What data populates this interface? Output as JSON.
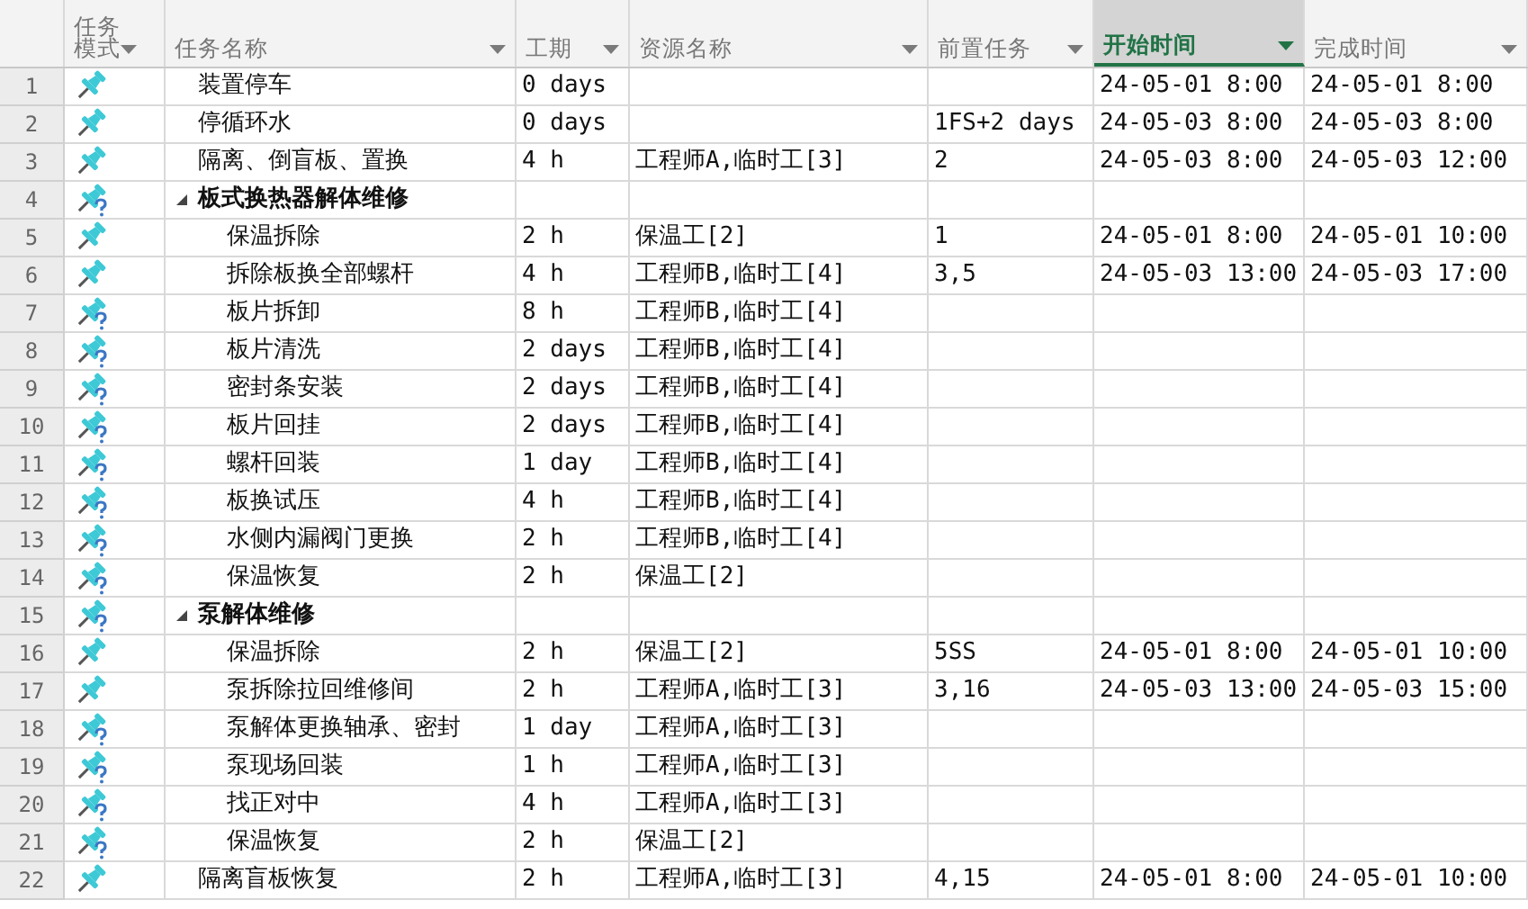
{
  "columns": [
    {
      "label": "任务模式",
      "selected": false
    },
    {
      "label": "任务名称",
      "selected": false
    },
    {
      "label": "工期",
      "selected": false
    },
    {
      "label": "资源名称",
      "selected": false
    },
    {
      "label": "前置任务",
      "selected": false
    },
    {
      "label": "开始时间",
      "selected": true
    },
    {
      "label": "完成时间",
      "selected": false
    }
  ],
  "tasks": [
    {
      "id": "1",
      "kind": "pin",
      "name": "装置停车",
      "duration": "0 days",
      "start": "24-05-01 8:00",
      "finish": "24-05-01 8:00"
    },
    {
      "id": "2",
      "kind": "pin",
      "name": "停循环水",
      "duration": "0 days",
      "predecessors": "1FS+2 days",
      "start": "24-05-03 8:00",
      "finish": "24-05-03 8:00"
    },
    {
      "id": "3",
      "kind": "pin",
      "name": "隔离、倒盲板、置换",
      "duration": "4 h",
      "resources": "工程师A,临时工[3]",
      "predecessors": "2",
      "start": "24-05-03 8:00",
      "finish": "24-05-03 12:00"
    },
    {
      "id": "4",
      "kind": "pin_question",
      "name": "板式换热器解体维修",
      "expanded": true,
      "children": [
        {
          "id": "5",
          "kind": "pin",
          "name": "保温拆除",
          "duration": "2 h",
          "resources": "保温工[2]",
          "predecessors": "1",
          "start": "24-05-01 8:00",
          "finish": "24-05-01 10:00"
        },
        {
          "id": "6",
          "kind": "pin",
          "name": "拆除板换全部螺杆",
          "duration": "4 h",
          "resources": "工程师B,临时工[4]",
          "predecessors": "3,5",
          "start": "24-05-03 13:00",
          "finish": "24-05-03 17:00"
        },
        {
          "id": "7",
          "kind": "pin_question",
          "name": "板片拆卸",
          "duration": "8 h",
          "resources": "工程师B,临时工[4]"
        },
        {
          "id": "8",
          "kind": "pin_question",
          "name": "板片清洗",
          "duration": "2 days",
          "resources": "工程师B,临时工[4]"
        },
        {
          "id": "9",
          "kind": "pin_question",
          "name": "密封条安装",
          "duration": "2 days",
          "resources": "工程师B,临时工[4]"
        },
        {
          "id": "10",
          "kind": "pin_question",
          "name": "板片回挂",
          "duration": "2 days",
          "resources": "工程师B,临时工[4]"
        },
        {
          "id": "11",
          "kind": "pin_question",
          "name": "螺杆回装",
          "duration": "1 day",
          "resources": "工程师B,临时工[4]"
        },
        {
          "id": "12",
          "kind": "pin_question",
          "name": "板换试压",
          "duration": "4 h",
          "resources": "工程师B,临时工[4]"
        },
        {
          "id": "13",
          "kind": "pin_question",
          "name": "水侧内漏阀门更换",
          "duration": "2 h",
          "resources": "工程师B,临时工[4]"
        },
        {
          "id": "14",
          "kind": "pin_question",
          "name": "保温恢复",
          "duration": "2 h",
          "resources": "保温工[2]"
        }
      ]
    },
    {
      "id": "15",
      "kind": "pin_question",
      "name": "泵解体维修",
      "expanded": true,
      "children": [
        {
          "id": "16",
          "kind": "pin",
          "name": "保温拆除",
          "duration": "2 h",
          "resources": "保温工[2]",
          "predecessors": "5SS",
          "start": "24-05-01 8:00",
          "finish": "24-05-01 10:00"
        },
        {
          "id": "17",
          "kind": "pin",
          "name": "泵拆除拉回维修间",
          "duration": "2 h",
          "resources": "工程师A,临时工[3]",
          "predecessors": "3,16",
          "start": "24-05-03 13:00",
          "finish": "24-05-03 15:00"
        },
        {
          "id": "18",
          "kind": "pin_question",
          "name": "泵解体更换轴承、密封",
          "duration": "1 day",
          "resources": "工程师A,临时工[3]"
        },
        {
          "id": "19",
          "kind": "pin_question",
          "name": "泵现场回装",
          "duration": "1 h",
          "resources": "工程师A,临时工[3]"
        },
        {
          "id": "20",
          "kind": "pin_question",
          "name": "找正对中",
          "duration": "4 h",
          "resources": "工程师A,临时工[3]"
        },
        {
          "id": "21",
          "kind": "pin_question",
          "name": "保温恢复",
          "duration": "2 h",
          "resources": "保温工[2]"
        }
      ]
    },
    {
      "id": "22",
      "kind": "pin",
      "name": "隔离盲板恢复",
      "duration": "2 h",
      "resources": "工程师A,临时工[3]",
      "predecessors": "4,15",
      "start": "24-05-01 8:00",
      "finish": "24-05-01 10:00"
    }
  ]
}
